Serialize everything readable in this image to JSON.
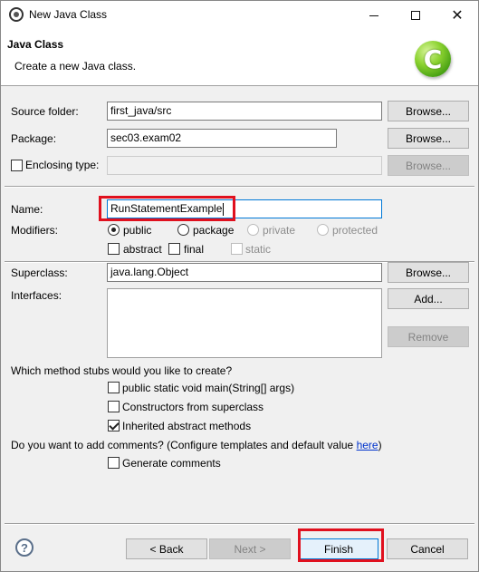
{
  "window": {
    "title": "New Java Class"
  },
  "banner": {
    "title": "Java Class",
    "description": "Create a new Java class."
  },
  "source_folder": {
    "label": "Source folder:",
    "value": "first_java/src",
    "browse": "Browse..."
  },
  "package": {
    "label": "Package:",
    "value": "sec03.exam02",
    "browse": "Browse..."
  },
  "enclosing": {
    "label": "Enclosing type:",
    "value": "",
    "browse": "Browse..."
  },
  "name": {
    "label": "Name:",
    "value": "RunStatementExample"
  },
  "modifiers": {
    "label": "Modifiers:",
    "public": "public",
    "package": "package",
    "private": "private",
    "protected": "protected",
    "abstract": "abstract",
    "final": "final",
    "static": "static"
  },
  "superclass": {
    "label": "Superclass:",
    "value": "java.lang.Object",
    "browse": "Browse..."
  },
  "interfaces": {
    "label": "Interfaces:",
    "add": "Add...",
    "remove": "Remove"
  },
  "stubs": {
    "question": "Which method stubs would you like to create?",
    "main": "public static void main(String[] args)",
    "constructors": "Constructors from superclass",
    "inherited": "Inherited abstract methods"
  },
  "comments": {
    "question": "Do you want to add comments? (Configure templates and default value ",
    "link": "here",
    "question_end": ")",
    "generate": "Generate comments"
  },
  "footer": {
    "back": "< Back",
    "next": "Next >",
    "finish": "Finish",
    "cancel": "Cancel",
    "help": "?"
  },
  "colors": {
    "highlight": "#e0101e",
    "link": "#0033cc"
  }
}
